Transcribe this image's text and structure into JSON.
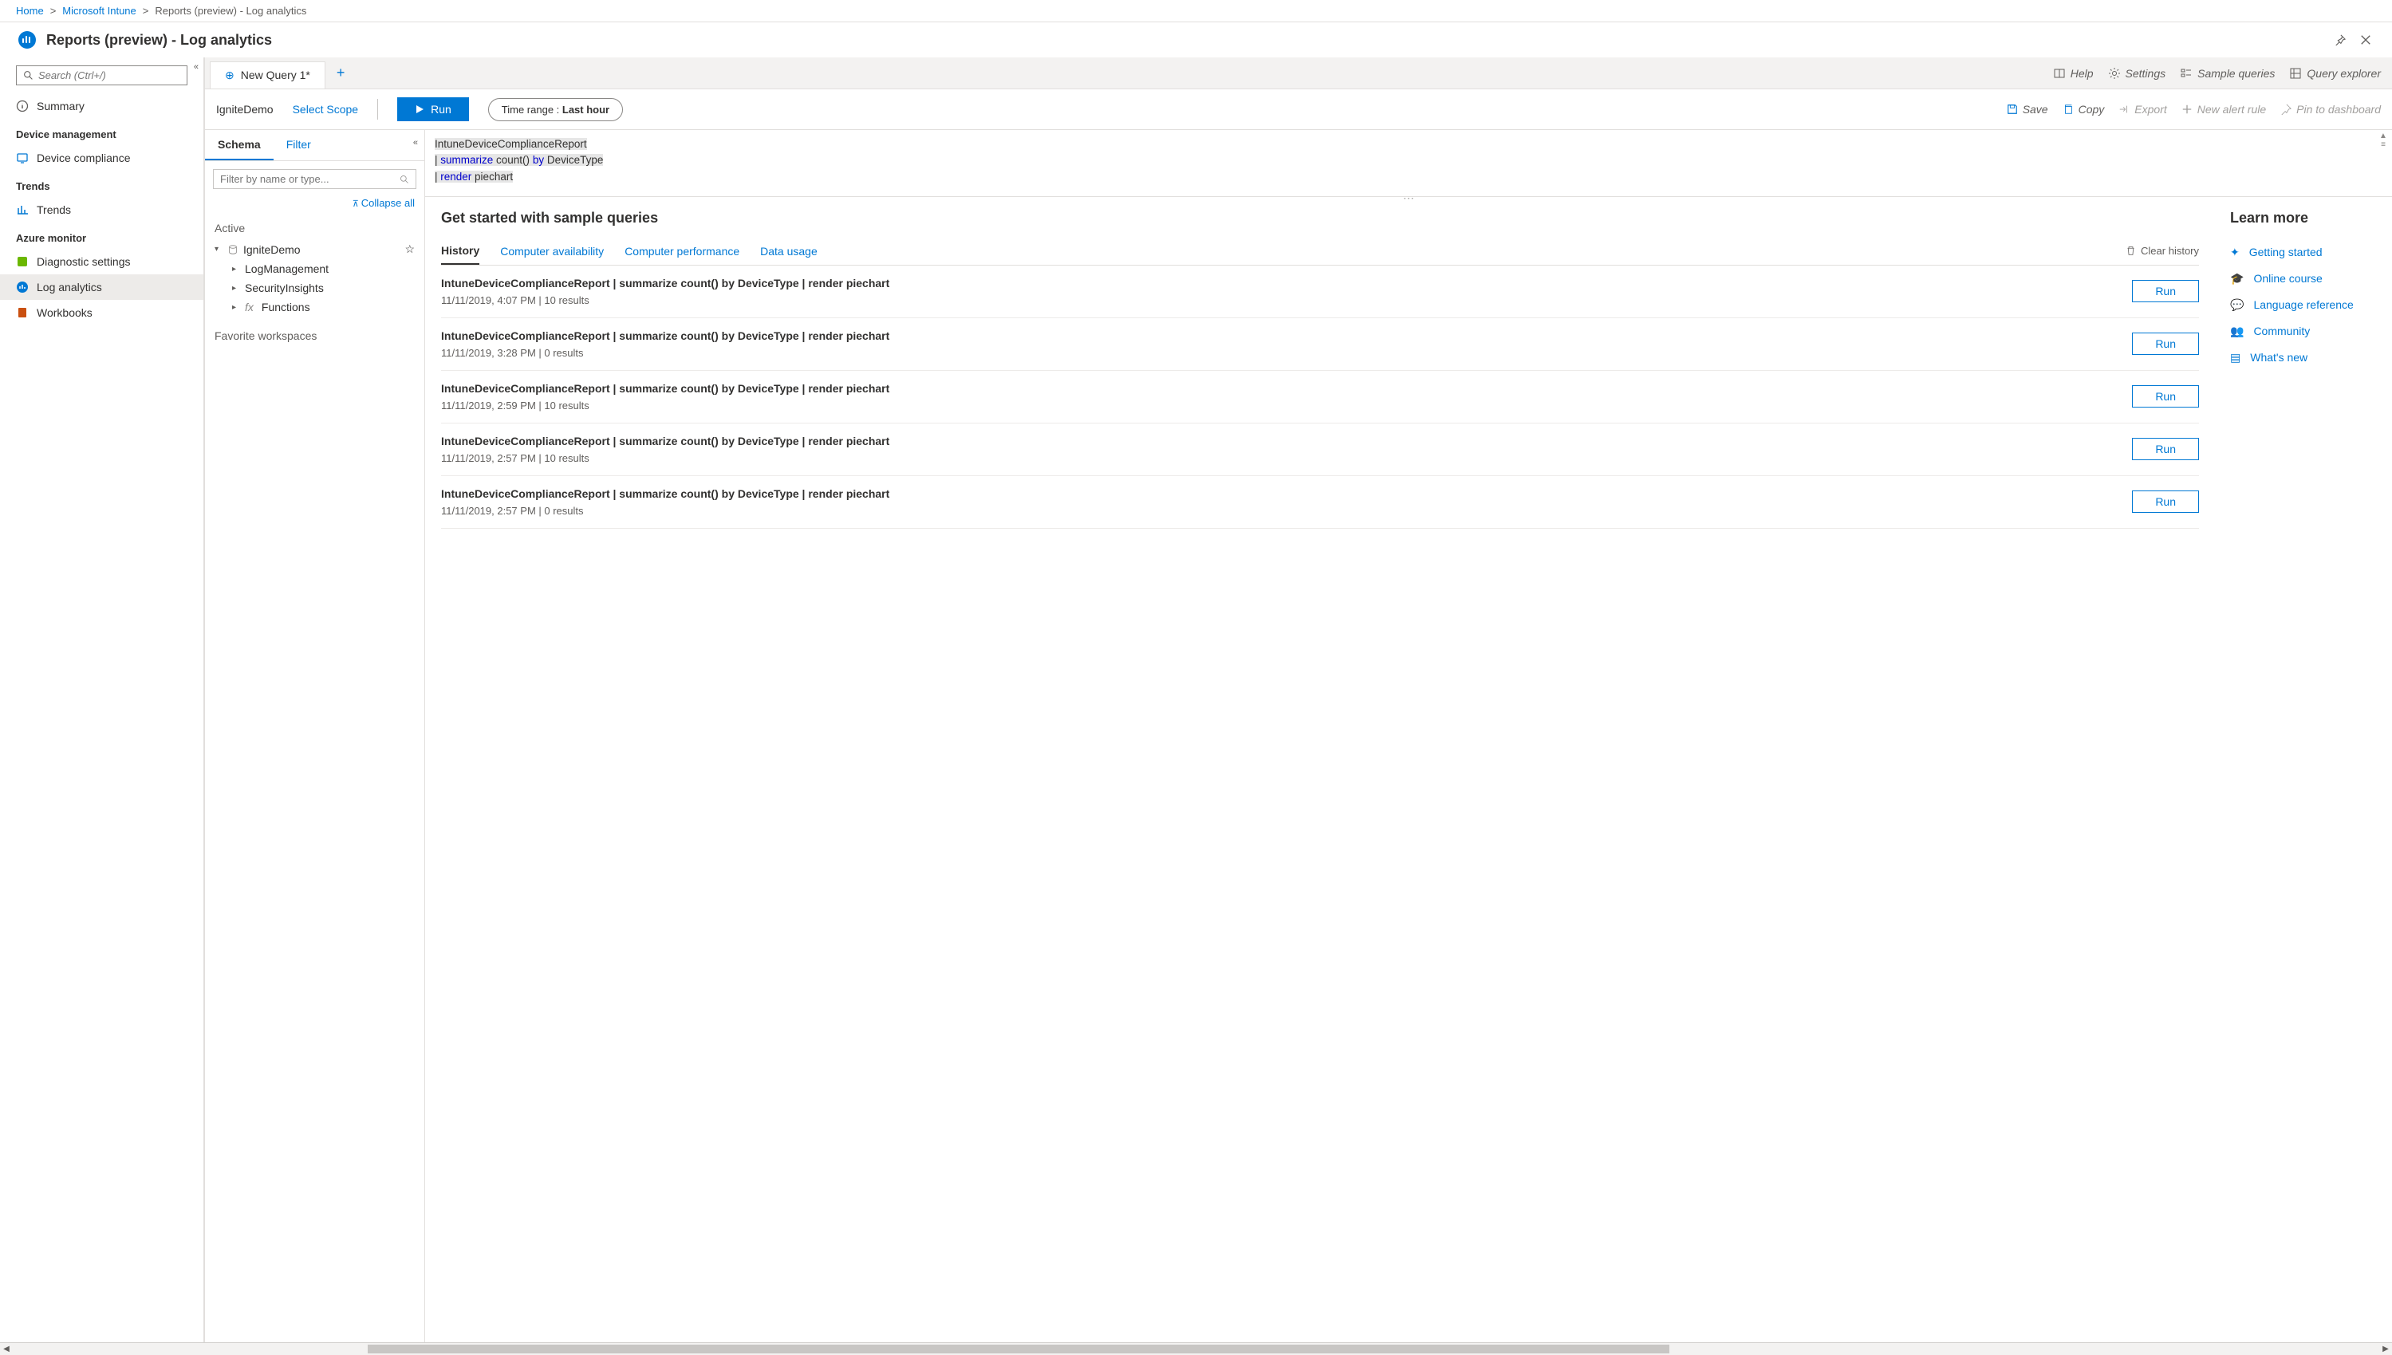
{
  "breadcrumb": {
    "home": "Home",
    "intune": "Microsoft Intune",
    "current": "Reports (preview) - Log analytics"
  },
  "page_title": "Reports (preview) - Log analytics",
  "left_search_placeholder": "Search (Ctrl+/)",
  "sidebar": {
    "summary": "Summary",
    "g1": "Device management",
    "device_compliance": "Device compliance",
    "g2": "Trends",
    "trends": "Trends",
    "g3": "Azure monitor",
    "diag": "Diagnostic settings",
    "loga": "Log analytics",
    "wb": "Workbooks"
  },
  "tabbar": {
    "tab": "New Query 1*",
    "help": "Help",
    "settings": "Settings",
    "sample": "Sample queries",
    "explorer": "Query explorer"
  },
  "toolbar": {
    "scope": "IgniteDemo",
    "select_scope": "Select Scope",
    "run": "Run",
    "time_label": "Time range : ",
    "time_val": "Last hour",
    "save": "Save",
    "copy": "Copy",
    "export": "Export",
    "alert": "New alert rule",
    "pin": "Pin to dashboard"
  },
  "schema": {
    "tab_schema": "Schema",
    "tab_filter": "Filter",
    "filter_placeholder": "Filter by name or type...",
    "collapse": "Collapse all",
    "active": "Active",
    "ws": "IgniteDemo",
    "n1": "LogManagement",
    "n2": "SecurityInsights",
    "n3": "Functions",
    "fav": "Favorite workspaces"
  },
  "code": {
    "l1": "IntuneDeviceComplianceReport",
    "l2a": "| ",
    "l2_kw": "summarize",
    "l2b": " count() ",
    "l2_kw2": "by",
    "l2c": " DeviceType",
    "l3a": "| ",
    "l3_kw": "render",
    "l3b": " piechart"
  },
  "sample": {
    "title": "Get started with sample queries",
    "tabs": {
      "history": "History",
      "ca": "Computer availability",
      "cp": "Computer performance",
      "du": "Data usage"
    },
    "clear": "Clear history",
    "run": "Run",
    "rows": [
      {
        "q": "IntuneDeviceComplianceReport | summarize count() by DeviceType | render piechart",
        "meta": "11/11/2019, 4:07 PM | 10 results"
      },
      {
        "q": "IntuneDeviceComplianceReport | summarize count() by DeviceType | render piechart",
        "meta": "11/11/2019, 3:28 PM | 0 results"
      },
      {
        "q": "IntuneDeviceComplianceReport | summarize count() by DeviceType | render piechart",
        "meta": "11/11/2019, 2:59 PM | 10 results"
      },
      {
        "q": "IntuneDeviceComplianceReport | summarize count() by DeviceType | render piechart",
        "meta": "11/11/2019, 2:57 PM | 10 results"
      },
      {
        "q": "IntuneDeviceComplianceReport | summarize count() by DeviceType | render piechart",
        "meta": "11/11/2019, 2:57 PM | 0 results"
      }
    ]
  },
  "learn": {
    "title": "Learn more",
    "gs": "Getting started",
    "oc": "Online course",
    "lr": "Language reference",
    "cm": "Community",
    "wn": "What's new"
  }
}
